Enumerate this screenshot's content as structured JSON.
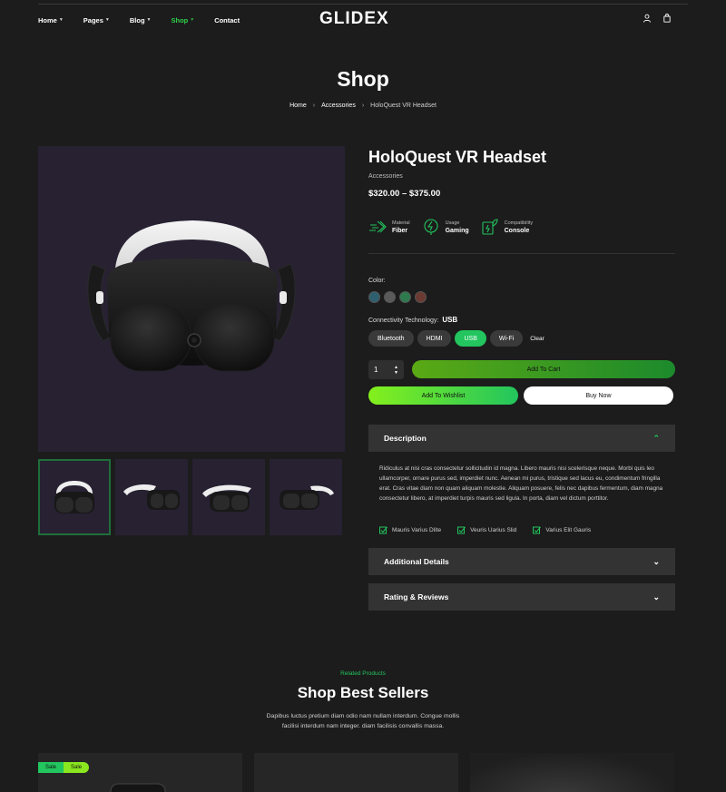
{
  "nav": {
    "items": [
      {
        "label": "Home",
        "caret": true,
        "active": false
      },
      {
        "label": "Pages",
        "caret": true,
        "active": false
      },
      {
        "label": "Blog",
        "caret": true,
        "active": false
      },
      {
        "label": "Shop",
        "caret": true,
        "active": true
      },
      {
        "label": "Contact",
        "caret": false,
        "active": false
      }
    ],
    "logo": "GLIDEX",
    "icons": [
      "user-icon",
      "bag-icon"
    ]
  },
  "hero": {
    "title": "Shop",
    "breadcrumb": [
      "Home",
      "Accessories",
      "HoloQuest VR Headset"
    ]
  },
  "product": {
    "title": "HoloQuest VR Headset",
    "category": "Accessories",
    "price": "$320.00 – $375.00",
    "features": [
      {
        "icon": "fiber-icon",
        "label": "Material",
        "value": "Fiber"
      },
      {
        "icon": "lightning-icon",
        "label": "Usage",
        "value": "Gaming"
      },
      {
        "icon": "eco-power-icon",
        "label": "Compatibility",
        "value": "Console"
      }
    ],
    "color_label": "Color:",
    "colors": [
      "#2f5f6e",
      "#5a5a5a",
      "#2e7a4e",
      "#6b3a32"
    ],
    "connectivity_label": "Connectivity Technology:",
    "connectivity_selected": "USB",
    "connectivity_options": [
      "Bluetooth",
      "HDMI",
      "USB",
      "Wi-Fi"
    ],
    "clear_label": "Clear",
    "quantity": "1",
    "add_to_cart": "Add To Cart",
    "add_to_wishlist": "Add To Wishlist",
    "buy_now": "Buy Now"
  },
  "accordion": {
    "description_title": "Description",
    "description_text": "Ridiculus at nisi cras consectetur sollicitudin id magna. Libero mauris nisi scelerisque neque. Morbi quis leo ullamcorper, ornare purus sed, imperdiet nunc. Aenean mi purus, tristique sed lacus eu, condimentum fringilla erat. Cras vitae diam non quam aliquam molestie. Aliquam posuere, felis nec dapibus fermentum, diam magna consectetur libero, at imperdiet turpis mauris sed ligula. In porta, diam vel dictum porttitor.",
    "checks": [
      "Mauris Varius Dlite",
      "Veuris Uarius Slid",
      "Varius Elit Gauris"
    ],
    "additional_title": "Additional Details",
    "rating_title": "Rating & Reviews"
  },
  "related": {
    "subtitle": "Related Products",
    "title": "Shop Best Sellers",
    "description_line1": "Dapibus luctus pretium diam odio nam nullam interdum. Congue mollis",
    "description_line2": "facilisi interdum nam integer. diam facilisis convallis massa.",
    "badges": [
      "Sale",
      "Sale"
    ]
  },
  "colors": {
    "accent": "#22c55e",
    "background": "#1c1c1c",
    "panel": "#333333",
    "image_bg": "#272132"
  }
}
